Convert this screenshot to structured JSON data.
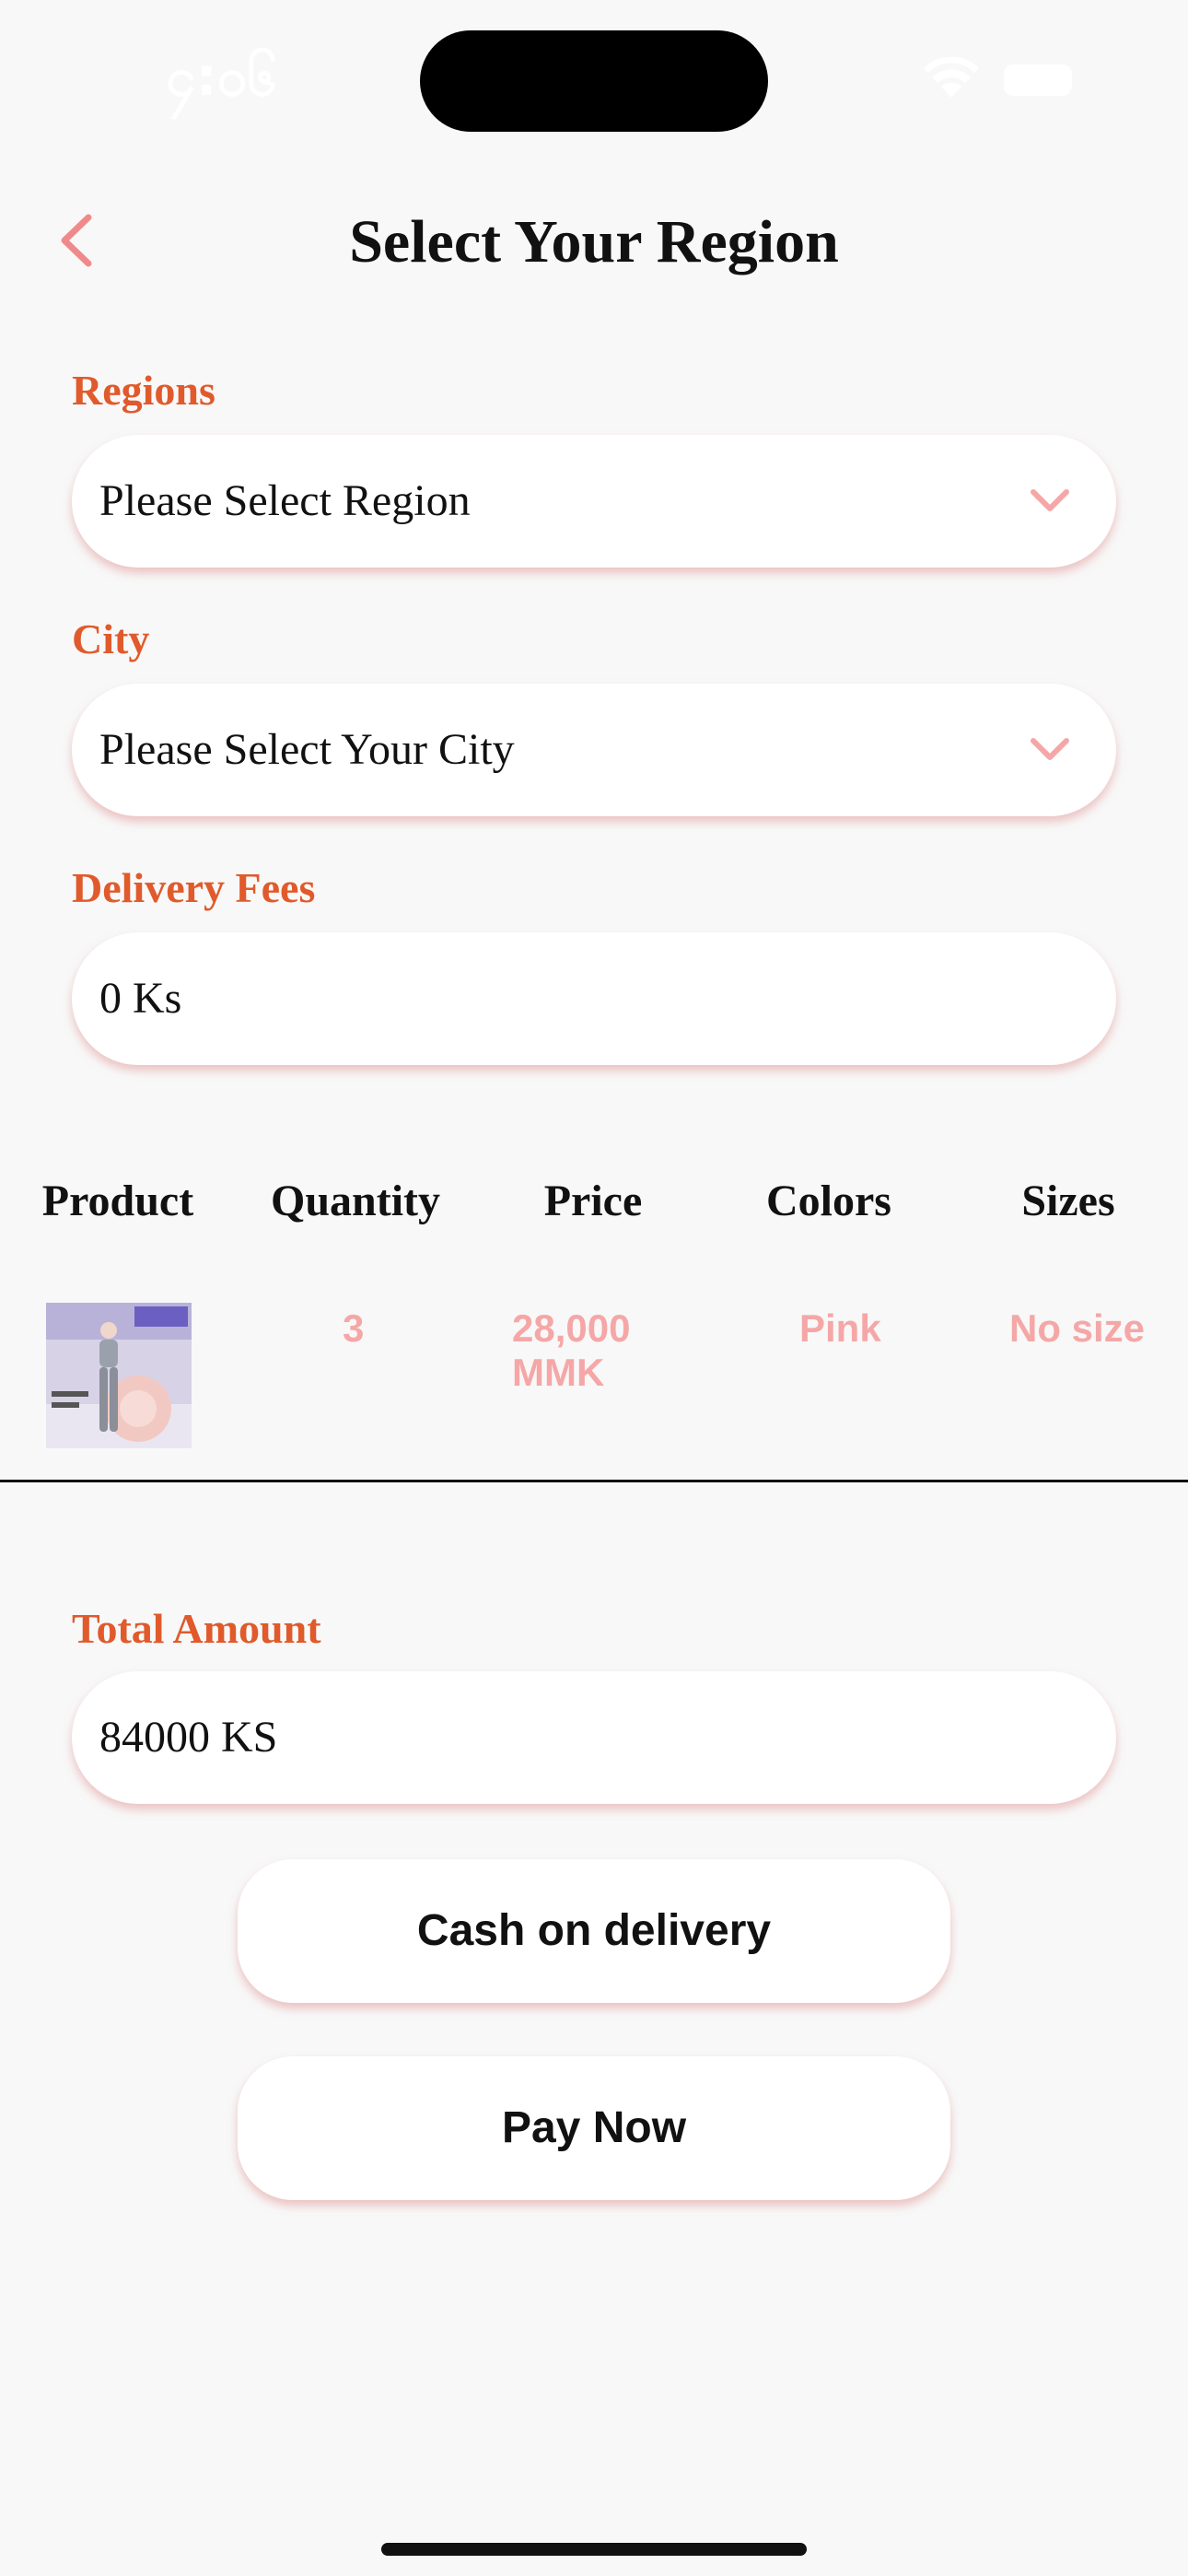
{
  "status_bar": {
    "time": "၄:၀၆"
  },
  "header": {
    "title": "Select Your Region"
  },
  "form": {
    "regions_label": "Regions",
    "regions_value": "Please Select Region",
    "city_label": "City",
    "city_value": "Please Select Your City",
    "delivery_label": "Delivery Fees",
    "delivery_value": "0 Ks",
    "total_label": "Total Amount",
    "total_value": "84000 KS"
  },
  "table": {
    "headers": [
      "Product",
      "Quantity",
      "Price",
      "Colors",
      "Sizes"
    ],
    "rows": [
      {
        "quantity": "3",
        "price_line1": "28,000",
        "price_line2": "MMK",
        "color": "Pink",
        "size": "No size"
      }
    ]
  },
  "buttons": {
    "cash_on_delivery": "Cash on delivery",
    "pay_now": "Pay Now"
  },
  "colors": {
    "accent_label": "#e05a2b",
    "accent_pink": "#f5a7a7",
    "background": "#f8f8f8"
  }
}
